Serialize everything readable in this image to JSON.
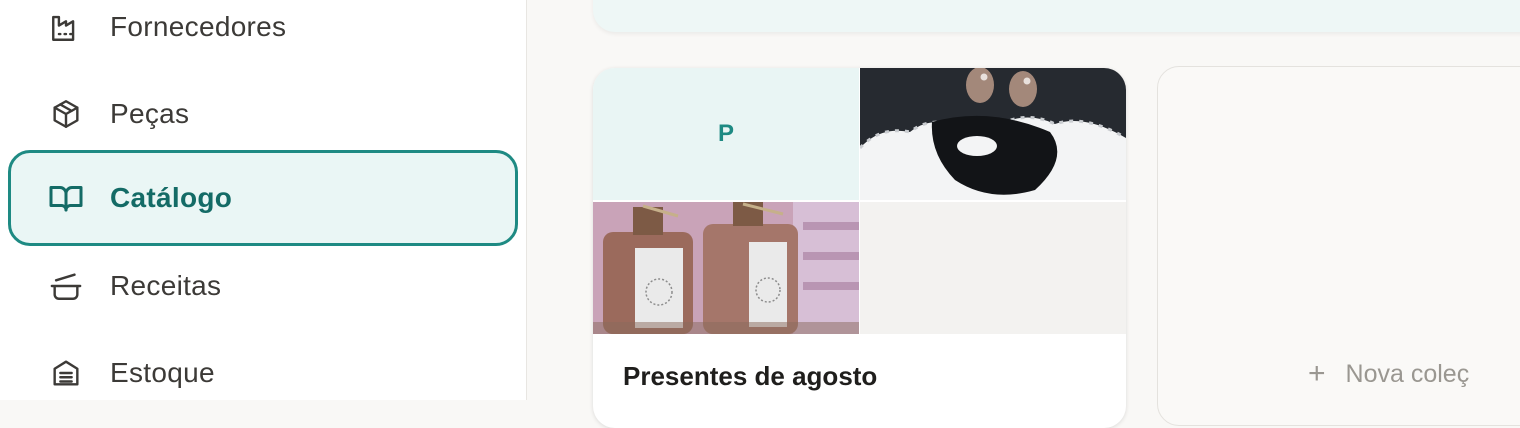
{
  "sidebar": {
    "items": [
      {
        "label": "Fornecedores",
        "icon": "factory-icon"
      },
      {
        "label": "Peças",
        "icon": "box-icon"
      },
      {
        "label": "Catálogo",
        "icon": "open-book-icon",
        "active": true
      },
      {
        "label": "Receitas",
        "icon": "cooking-pot-icon"
      },
      {
        "label": "Estoque",
        "icon": "archive-icon"
      }
    ]
  },
  "main": {
    "collection": {
      "name": "Presentes de agosto",
      "initial": "P"
    },
    "new_collection": {
      "label": "Nova coleç"
    }
  },
  "colors": {
    "accent": "#1e8a83",
    "accent_bg": "#eaf6f5",
    "text": "#3c3a37"
  }
}
